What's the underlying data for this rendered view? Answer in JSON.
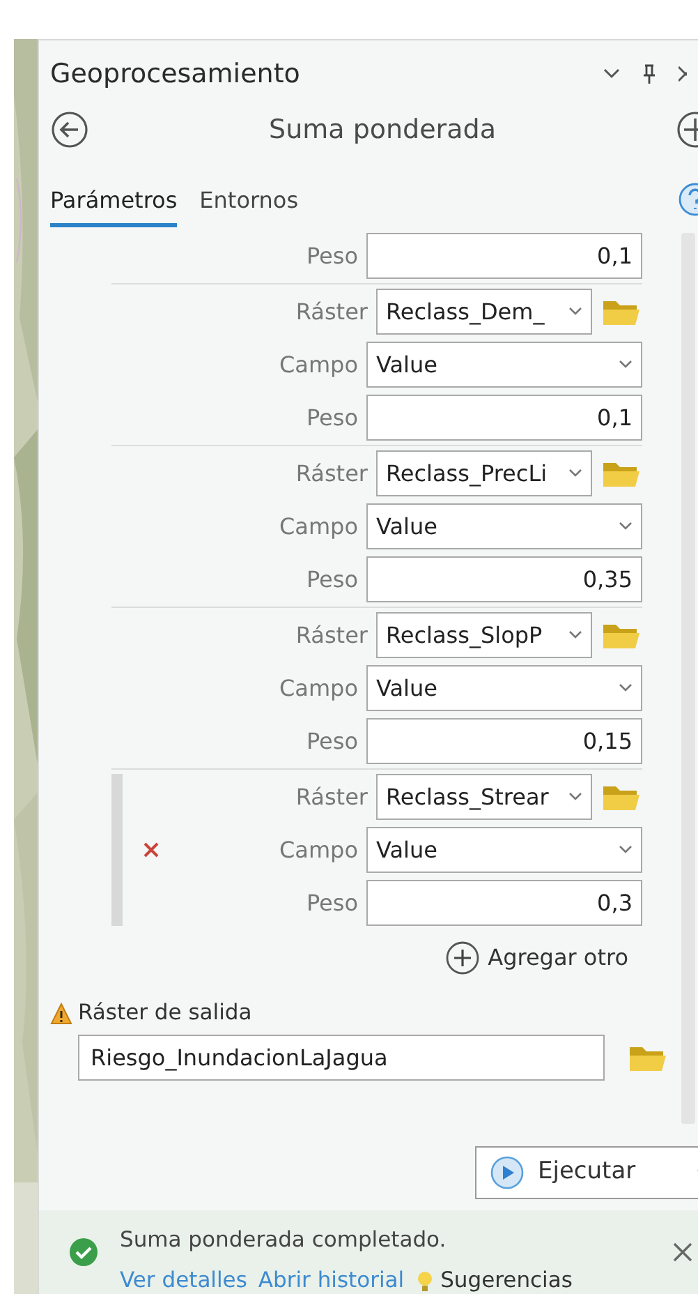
{
  "pane": {
    "title": "Geoprocesamiento",
    "tool_title": "Suma ponderada"
  },
  "tabs": [
    {
      "label": "Parámetros",
      "selected": true
    },
    {
      "label": "Entornos",
      "selected": false
    }
  ],
  "groups": [
    {
      "weight_label": "Peso",
      "weight": "0,1",
      "selected": false
    },
    {
      "raster_label": "Ráster",
      "raster": "Reclass_Dem_",
      "field_label": "Campo",
      "field": "Value",
      "weight_label": "Peso",
      "weight": "0,1",
      "selected": false
    },
    {
      "raster_label": "Ráster",
      "raster": "Reclass_PrecLi",
      "field_label": "Campo",
      "field": "Value",
      "weight_label": "Peso",
      "weight": "0,35",
      "selected": false
    },
    {
      "raster_label": "Ráster",
      "raster": "Reclass_SlopP",
      "field_label": "Campo",
      "field": "Value",
      "weight_label": "Peso",
      "weight": "0,15",
      "selected": false
    },
    {
      "raster_label": "Ráster",
      "raster": "Reclass_Strear",
      "field_label": "Campo",
      "field": "Value",
      "weight_label": "Peso",
      "weight": "0,3",
      "selected": true
    }
  ],
  "add_button": "Agregar otro",
  "output": {
    "label": "Ráster de salida",
    "warning": true,
    "value": "Riesgo_InundacionLaJagua"
  },
  "run_button": "Ejecutar",
  "message": {
    "text": "Suma ponderada completado.",
    "links": [
      "Ver detalles",
      "Abrir historial"
    ],
    "tips": "Sugerencias"
  }
}
